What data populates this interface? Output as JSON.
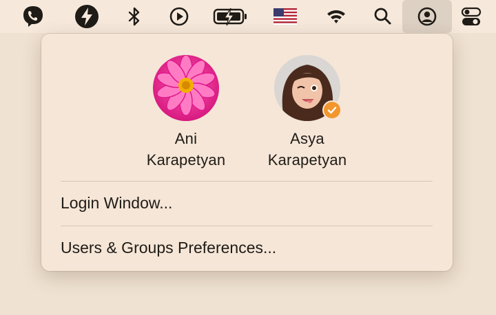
{
  "menubar": {
    "icons": [
      "viber-icon",
      "bolt-icon",
      "bluetooth-icon",
      "play-circle-icon",
      "battery-charging-icon",
      "us-flag-icon",
      "wifi-icon",
      "search-icon",
      "user-circle-icon",
      "control-center-icon"
    ]
  },
  "users": [
    {
      "first_name": "Ani",
      "last_name": "Karapetyan",
      "avatar": "pink-flower-photo",
      "logged_in": false
    },
    {
      "first_name": "Asya",
      "last_name": "Karapetyan",
      "avatar": "memoji-winking",
      "logged_in": true
    }
  ],
  "menu": {
    "login_window": "Login Window...",
    "users_groups": "Users & Groups Preferences..."
  },
  "colors": {
    "panel_bg": "#f5e6d7",
    "menubar_bg": "#f6e9dc",
    "check_badge": "#f2962d"
  }
}
